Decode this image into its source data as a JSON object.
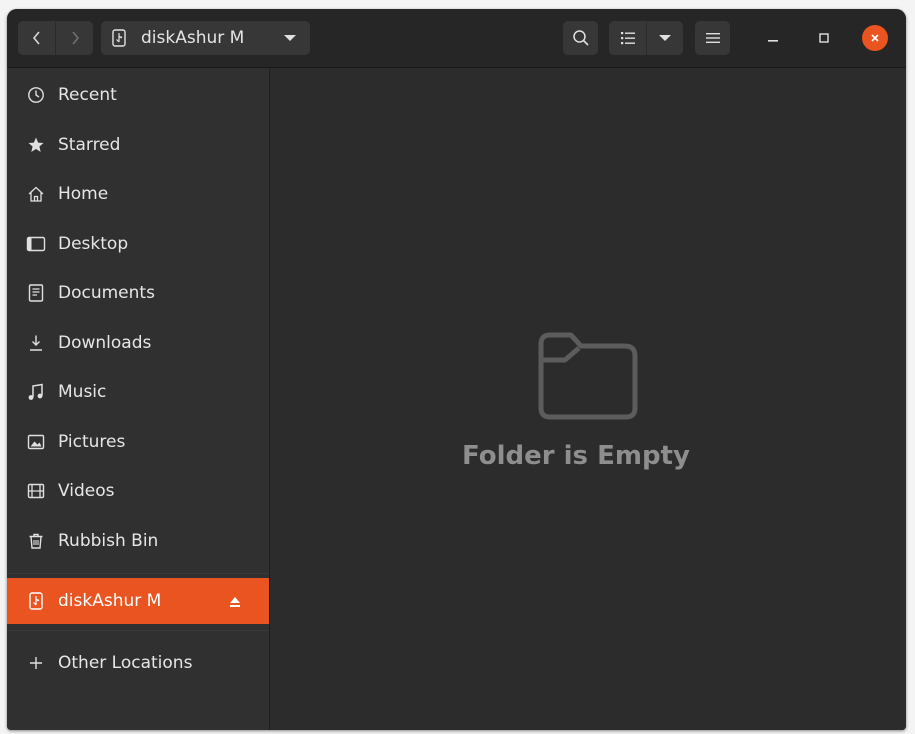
{
  "header": {
    "location": "diskAshur M"
  },
  "sidebar": {
    "places": [
      {
        "label": "Recent",
        "icon": "recent-icon"
      },
      {
        "label": "Starred",
        "icon": "star-icon"
      },
      {
        "label": "Home",
        "icon": "home-icon"
      },
      {
        "label": "Desktop",
        "icon": "desktop-icon"
      },
      {
        "label": "Documents",
        "icon": "documents-icon"
      },
      {
        "label": "Downloads",
        "icon": "downloads-icon"
      },
      {
        "label": "Music",
        "icon": "music-icon"
      },
      {
        "label": "Pictures",
        "icon": "pictures-icon"
      },
      {
        "label": "Videos",
        "icon": "videos-icon"
      },
      {
        "label": "Rubbish Bin",
        "icon": "trash-icon"
      }
    ],
    "drive": {
      "label": "diskAshur M",
      "icon": "usb-drive-icon"
    },
    "other": {
      "label": "Other Locations",
      "icon": "plus-icon"
    }
  },
  "content": {
    "empty_message": "Folder is Empty"
  },
  "colors": {
    "accent": "#e95420",
    "window_bg": "#2c2c2c",
    "sidebar_bg": "#303030",
    "headerbar_bg": "#262626",
    "close_button": "#e95420"
  }
}
